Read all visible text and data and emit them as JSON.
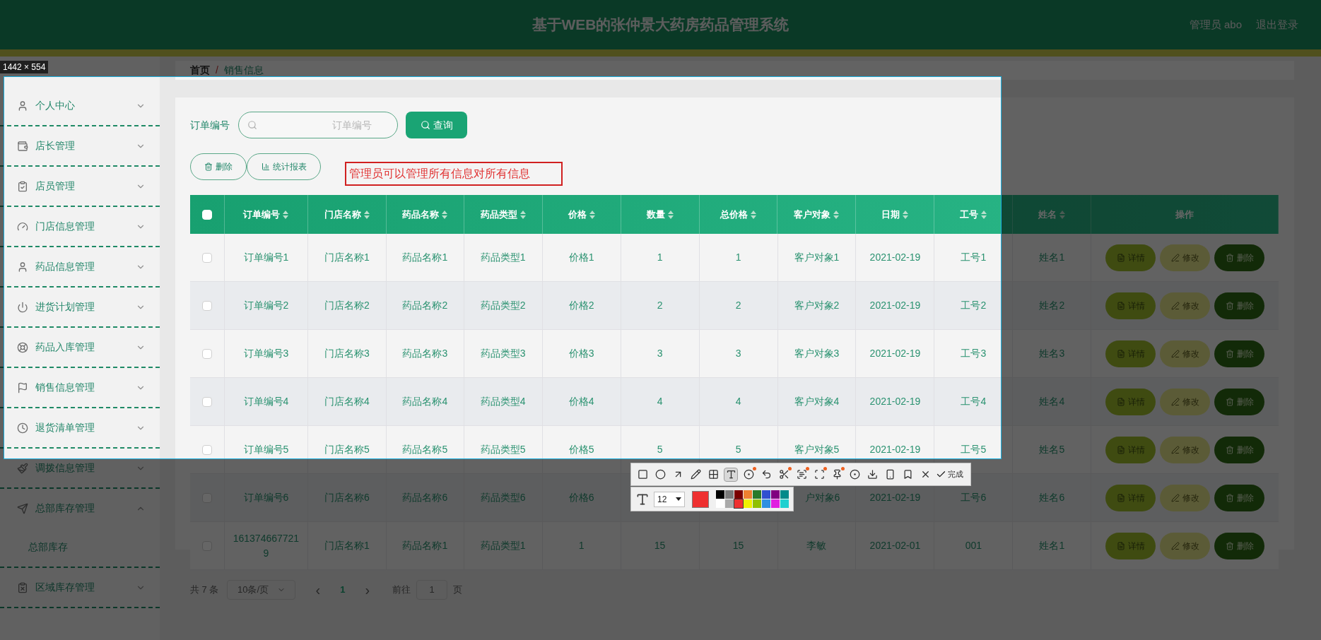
{
  "header": {
    "title": "基于WEB的张仲景大药房药品管理系统",
    "user": "管理员 abo",
    "logout": "退出登录"
  },
  "sidebar": {
    "items": [
      {
        "label": "个人中心",
        "expanded": false
      },
      {
        "label": "店长管理",
        "expanded": false
      },
      {
        "label": "店员管理",
        "expanded": false
      },
      {
        "label": "门店信息管理",
        "expanded": false
      },
      {
        "label": "药品信息管理",
        "expanded": false
      },
      {
        "label": "进货计划管理",
        "expanded": false
      },
      {
        "label": "药品入库管理",
        "expanded": false
      },
      {
        "label": "销售信息管理",
        "expanded": false
      },
      {
        "label": "退货清单管理",
        "expanded": false
      },
      {
        "label": "调拨信息管理",
        "expanded": false
      },
      {
        "label": "总部库存管理",
        "expanded": true,
        "children": [
          {
            "label": "总部库存"
          }
        ]
      },
      {
        "label": "区域库存管理",
        "expanded": false
      }
    ]
  },
  "breadcrumb": {
    "home": "首页",
    "separator": "/",
    "current": "销售信息"
  },
  "search": {
    "label": "订单编号",
    "placeholder": "订单编号",
    "button": "查询"
  },
  "actions": [
    {
      "label": "删除"
    },
    {
      "label": "统计报表"
    }
  ],
  "table": {
    "header_checked": false,
    "columns": [
      {
        "label": "订单编号",
        "sortable": true
      },
      {
        "label": "门店名称",
        "sortable": true
      },
      {
        "label": "药品名称",
        "sortable": true
      },
      {
        "label": "药品类型",
        "sortable": true
      },
      {
        "label": "价格",
        "sortable": true
      },
      {
        "label": "数量",
        "sortable": true
      },
      {
        "label": "总价格",
        "sortable": true
      },
      {
        "label": "客户对象",
        "sortable": true
      },
      {
        "label": "日期",
        "sortable": true
      },
      {
        "label": "工号",
        "sortable": true
      },
      {
        "label": "姓名",
        "sortable": true
      },
      {
        "label": "操作",
        "sortable": false
      }
    ],
    "rows": [
      {
        "checked": false,
        "cells": [
          "订单编号1",
          "门店名称1",
          "药品名称1",
          "药品类型1",
          "价格1",
          "1",
          "1",
          "客户对象1",
          "2021-02-19",
          "工号1",
          "姓名1"
        ],
        "actions": [
          {
            "label": "详情",
            "kind": "detail"
          },
          {
            "label": "修改",
            "kind": "edit"
          },
          {
            "label": "删除",
            "kind": "delete"
          }
        ]
      },
      {
        "checked": false,
        "cells": [
          "订单编号2",
          "门店名称2",
          "药品名称2",
          "药品类型2",
          "价格2",
          "2",
          "2",
          "客户对象2",
          "2021-02-19",
          "工号2",
          "姓名2"
        ],
        "actions": [
          {
            "label": "详情",
            "kind": "detail"
          },
          {
            "label": "修改",
            "kind": "edit"
          },
          {
            "label": "删除",
            "kind": "delete"
          }
        ]
      },
      {
        "checked": false,
        "cells": [
          "订单编号3",
          "门店名称3",
          "药品名称3",
          "药品类型3",
          "价格3",
          "3",
          "3",
          "客户对象3",
          "2021-02-19",
          "工号3",
          "姓名3"
        ],
        "actions": [
          {
            "label": "详情",
            "kind": "detail"
          },
          {
            "label": "修改",
            "kind": "edit"
          },
          {
            "label": "删除",
            "kind": "delete"
          }
        ]
      },
      {
        "checked": false,
        "cells": [
          "订单编号4",
          "门店名称4",
          "药品名称4",
          "药品类型4",
          "价格4",
          "4",
          "4",
          "客户对象4",
          "2021-02-19",
          "工号4",
          "姓名4"
        ],
        "actions": [
          {
            "label": "详情",
            "kind": "detail"
          },
          {
            "label": "修改",
            "kind": "edit"
          },
          {
            "label": "删除",
            "kind": "delete"
          }
        ]
      },
      {
        "checked": false,
        "cells": [
          "订单编号5",
          "门店名称5",
          "药品名称5",
          "药品类型5",
          "价格5",
          "5",
          "5",
          "客户对象5",
          "2021-02-19",
          "工号5",
          "姓名5"
        ],
        "actions": [
          {
            "label": "详情",
            "kind": "detail"
          },
          {
            "label": "修改",
            "kind": "edit"
          },
          {
            "label": "删除",
            "kind": "delete"
          }
        ]
      },
      {
        "checked": false,
        "cells": [
          "订单编号6",
          "门店名称6",
          "药品名称6",
          "药品类型6",
          "价格6",
          null,
          null,
          "户对象6",
          "2021-02-19",
          "工号6",
          "姓名6"
        ],
        "actions": [
          {
            "label": "详情",
            "kind": "detail"
          },
          {
            "label": "修改",
            "kind": "edit"
          },
          {
            "label": "删除",
            "kind": "delete"
          }
        ]
      },
      {
        "checked": false,
        "cells": [
          "1613746677219",
          "门店名称1",
          "药品名称1",
          "药品类型1",
          "1",
          "15",
          "15",
          "李敏",
          "2021-02-01",
          "001",
          "姓名1"
        ],
        "actions": [
          {
            "label": "详情",
            "kind": "detail"
          },
          {
            "label": "修改",
            "kind": "edit"
          },
          {
            "label": "删除",
            "kind": "delete"
          }
        ]
      }
    ]
  },
  "pagination": {
    "total": "共 7 条",
    "page_size": "10条/页",
    "prev": "‹",
    "current": "1",
    "next": "›",
    "goto_label": "前往",
    "goto_value": "1",
    "goto_suffix": "页"
  },
  "capture": {
    "size_label": "1442 × 554",
    "annotation": "管理员可以管理所有信息对所有信息",
    "tools": [
      {
        "kind": "rect",
        "selected": false,
        "dot": false
      },
      {
        "kind": "circle",
        "selected": false,
        "dot": false
      },
      {
        "kind": "arrow",
        "selected": false,
        "dot": false
      },
      {
        "kind": "pencil",
        "selected": false,
        "dot": false
      },
      {
        "kind": "mosaic",
        "selected": false,
        "dot": false
      },
      {
        "kind": "text",
        "selected": true,
        "dot": false
      },
      {
        "kind": "number",
        "selected": false,
        "dot": true
      },
      {
        "kind": "undo",
        "selected": false,
        "dot": false
      },
      {
        "kind": "scissors",
        "selected": false,
        "dot": true
      },
      {
        "kind": "ocr",
        "selected": false,
        "dot": true
      },
      {
        "kind": "scan",
        "selected": false,
        "dot": true
      },
      {
        "kind": "pin",
        "selected": false,
        "dot": true
      },
      {
        "kind": "record",
        "selected": false,
        "dot": false
      },
      {
        "kind": "download",
        "selected": false,
        "dot": false
      },
      {
        "kind": "phone",
        "selected": false,
        "dot": false
      },
      {
        "kind": "bookmark",
        "selected": false,
        "dot": false
      },
      {
        "kind": "close",
        "selected": false,
        "dot": false
      }
    ],
    "done": "完成",
    "font_size": "12",
    "palette": [
      {
        "color": "#000000",
        "selected": false
      },
      {
        "color": "#7a7a7a",
        "selected": false
      },
      {
        "color": "#7a0000",
        "selected": false
      },
      {
        "color": "#ee8030",
        "selected": false
      },
      {
        "color": "#2a7a2a",
        "selected": false
      },
      {
        "color": "#3050d0",
        "selected": false
      },
      {
        "color": "#800080",
        "selected": false
      },
      {
        "color": "#008a8a",
        "selected": false
      },
      {
        "color": "#ffffff",
        "selected": false
      },
      {
        "color": "#aaaaaa",
        "selected": false
      },
      {
        "color": "#ee3030",
        "selected": true
      },
      {
        "color": "#f0f000",
        "selected": false
      },
      {
        "color": "#90c000",
        "selected": false
      },
      {
        "color": "#3090e0",
        "selected": false
      },
      {
        "color": "#e020e0",
        "selected": false
      },
      {
        "color": "#20d0d0",
        "selected": false
      }
    ]
  }
}
